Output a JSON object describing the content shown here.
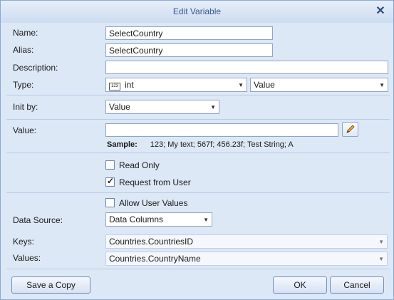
{
  "window": {
    "title": "Edit Variable"
  },
  "fields": {
    "name": {
      "label": "Name:",
      "value": "SelectCountry"
    },
    "alias": {
      "label": "Alias:",
      "value": "SelectCountry"
    },
    "description": {
      "label": "Description:",
      "value": ""
    },
    "type": {
      "label": "Type:",
      "value": "int",
      "icon_text": "123",
      "kind": "Value"
    },
    "init_by": {
      "label": "Init by:",
      "value": "Value"
    },
    "value": {
      "label": "Value:",
      "value": ""
    }
  },
  "sample": {
    "label": "Sample:",
    "text": "123; My text; 567f; 456.23f; Test String; A"
  },
  "options": {
    "read_only": {
      "label": "Read Only",
      "checked": false
    },
    "request_from_user": {
      "label": "Request from User",
      "checked": true
    },
    "allow_user_values": {
      "label": "Allow User Values",
      "checked": false
    }
  },
  "data_source": {
    "label": "Data Source:",
    "value": "Data Columns"
  },
  "keys": {
    "label": "Keys:",
    "value": "Countries.CountriesID"
  },
  "values": {
    "label": "Values:",
    "value": "Countries.CountryName"
  },
  "buttons": {
    "save_copy": "Save a Copy",
    "ok": "OK",
    "cancel": "Cancel"
  }
}
